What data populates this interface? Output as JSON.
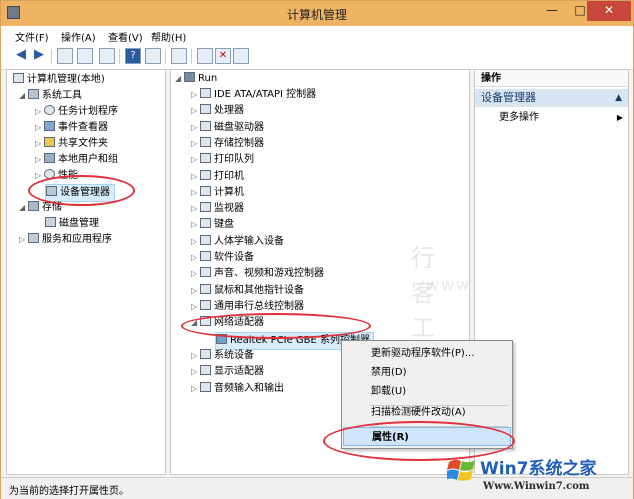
{
  "window": {
    "title": "计算机管理",
    "min": "—",
    "max": "□",
    "close": "✕"
  },
  "menu": [
    "文件(F)",
    "操作(A)",
    "查看(V)",
    "帮助(H)"
  ],
  "left_tree": {
    "root": "计算机管理(本地)",
    "system_tools": "系统工具",
    "task_scheduler": "任务计划程序",
    "event_viewer": "事件查看器",
    "shared_folders": "共享文件夹",
    "local_users": "本地用户和组",
    "performance": "性能",
    "device_manager": "设备管理器",
    "storage": "存储",
    "disk_mgmt": "磁盘管理",
    "services_apps": "服务和应用程序"
  },
  "device_tree": {
    "root": "Run",
    "items": [
      "IDE ATA/ATAPI 控制器",
      "处理器",
      "磁盘驱动器",
      "存储控制器",
      "打印队列",
      "打印机",
      "计算机",
      "监视器",
      "键盘",
      "人体学输入设备",
      "软件设备",
      "声音、视频和游戏控制器",
      "鼠标和其他指针设备",
      "通用串行总线控制器",
      "网络适配器"
    ],
    "network_child": "Realtek PCIe GBE 系列控制器",
    "after": [
      "系统设备",
      "显示适配器",
      "音频输入和输出"
    ]
  },
  "actions": {
    "header": "操作",
    "section": "设备管理器",
    "more": "更多操作"
  },
  "context_menu": {
    "update": "更新驱动程序软件(P)...",
    "disable": "禁用(D)",
    "uninstall": "卸载(U)",
    "scan": "扫描检测硬件改动(A)",
    "properties": "属性(R)"
  },
  "status": "为当前的选择打开属性页。",
  "watermark": {
    "brand": "Win7系统之家",
    "url": "Www.Winwin7.com",
    "ghost": "行 客 工 作 室",
    "ghost_url": "www.runker.net"
  }
}
